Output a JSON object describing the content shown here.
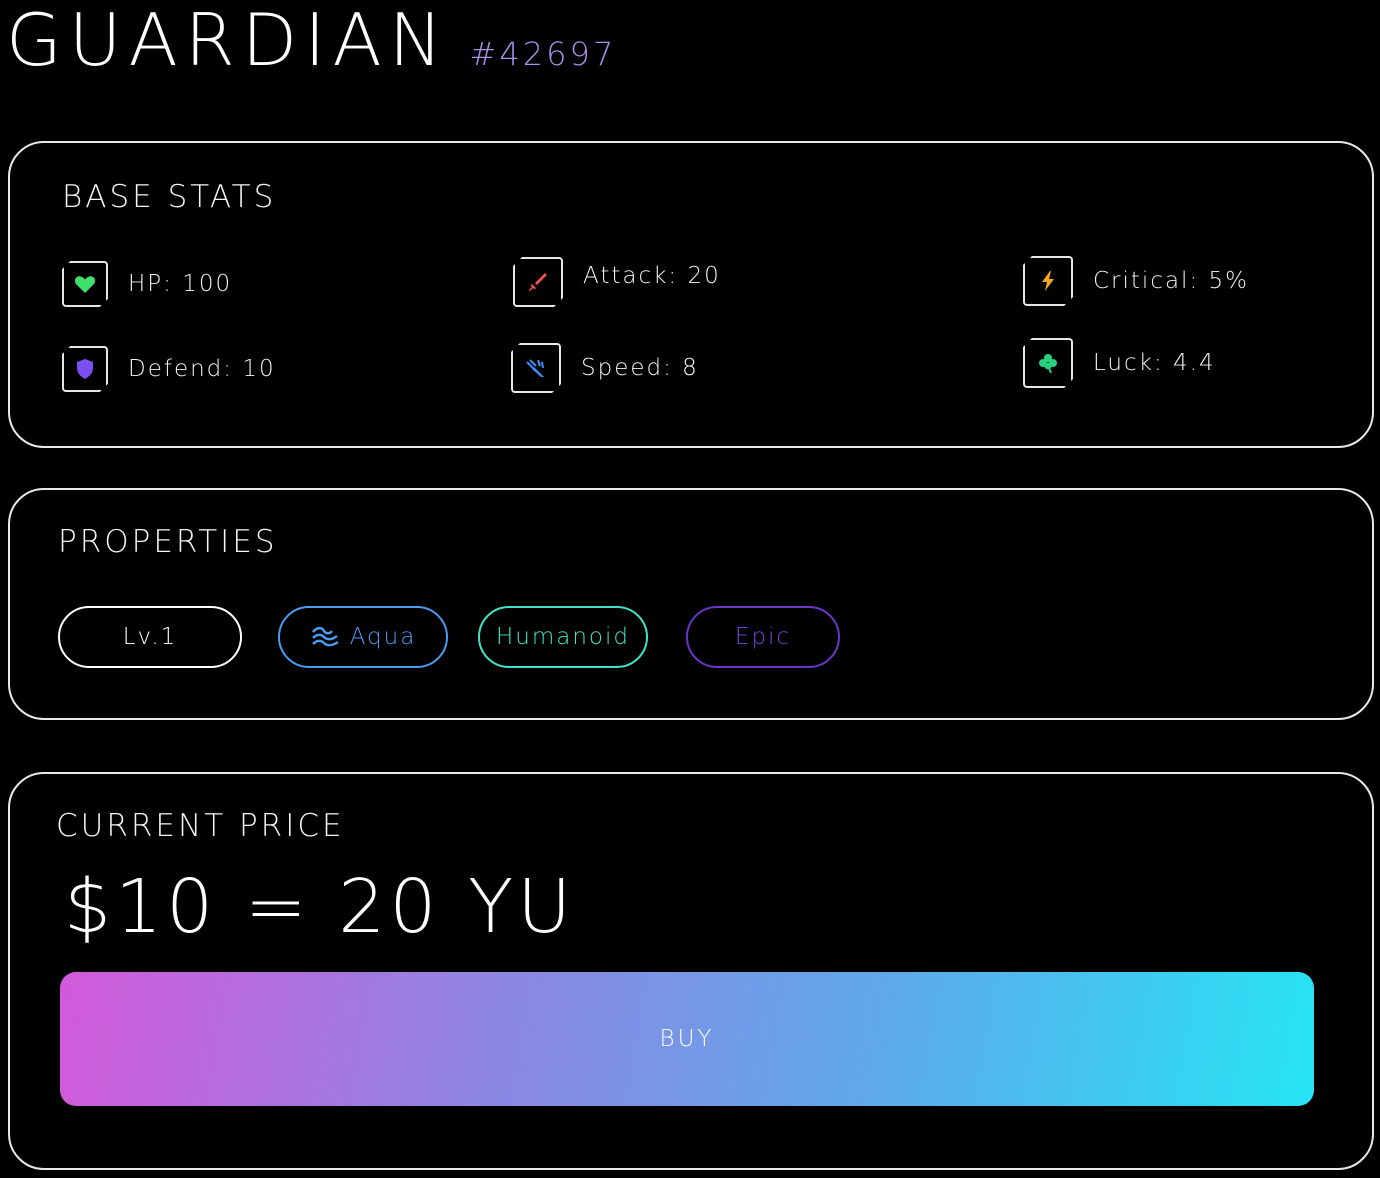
{
  "header": {
    "title": "GUARDIAN",
    "token_id": "#42697"
  },
  "base_stats": {
    "title": "BASE STATS",
    "items": [
      {
        "label": "HP: 100",
        "icon": "heart-icon",
        "color": "#3fe06a"
      },
      {
        "label": "Attack: 20",
        "icon": "sword-icon",
        "color": "#f0504a"
      },
      {
        "label": "Critical: 5%",
        "icon": "lightning-icon",
        "color": "#f5a623"
      },
      {
        "label": "Defend: 10",
        "icon": "shield-icon",
        "color": "#7b4ff0"
      },
      {
        "label": "Speed: 8",
        "icon": "speed-icon",
        "color": "#3d8ff5"
      },
      {
        "label": "Luck: 4.4",
        "icon": "clover-icon",
        "color": "#26d07c"
      }
    ]
  },
  "properties": {
    "title": "PROPERTIES",
    "tags": [
      {
        "label": "Lv.1",
        "color": "#ffffff"
      },
      {
        "label": "Aqua",
        "icon": "wave-icon",
        "color": "#4a9cf0"
      },
      {
        "label": "Humanoid",
        "color": "#41e4c8"
      },
      {
        "label": "Epic",
        "color": "#7b3fe0"
      }
    ]
  },
  "price": {
    "title": "CURRENT PRICE",
    "value": "$10 = 20 YU",
    "buy_label": "BUY"
  }
}
